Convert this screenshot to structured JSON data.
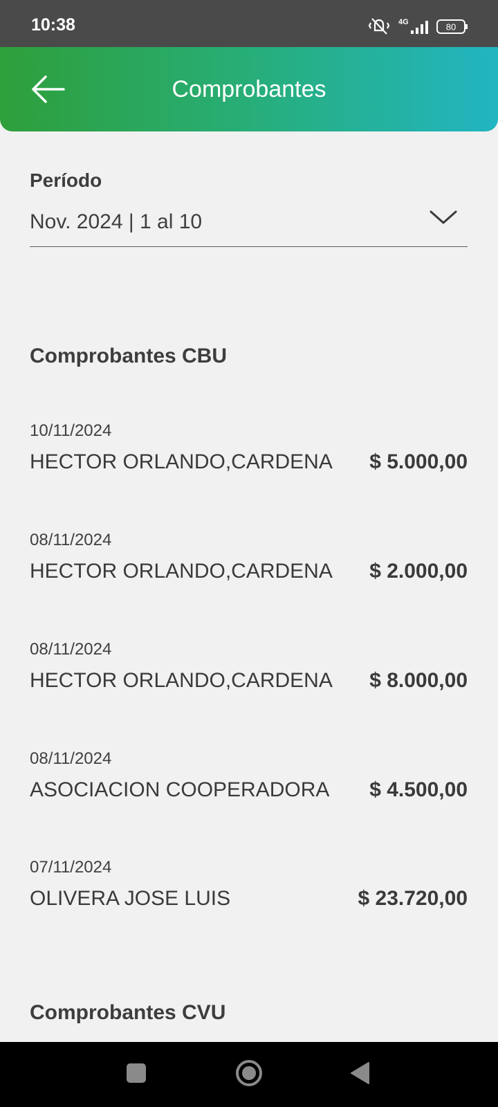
{
  "status": {
    "time": "10:38",
    "network": "4G",
    "battery": "80",
    "icons": [
      "mute-vibrate-icon",
      "signal-icon",
      "battery-icon"
    ]
  },
  "header": {
    "title": "Comprobantes",
    "back_icon": "arrow-left-icon"
  },
  "period": {
    "label": "Período",
    "value": "Nov. 2024 | 1 al 10",
    "icon": "chevron-down-icon"
  },
  "sections": {
    "cbu_title": "Comprobantes CBU",
    "cvu_title": "Comprobantes CVU"
  },
  "items": [
    {
      "date": "10/11/2024",
      "name": "HECTOR ORLANDO,CARDENA",
      "amount": "$ 5.000,00"
    },
    {
      "date": "08/11/2024",
      "name": "HECTOR ORLANDO,CARDENA",
      "amount": "$ 2.000,00"
    },
    {
      "date": "08/11/2024",
      "name": "HECTOR ORLANDO,CARDENA",
      "amount": "$ 8.000,00"
    },
    {
      "date": "08/11/2024",
      "name": "ASOCIACION COOPERADORA",
      "amount": "$ 4.500,00"
    },
    {
      "date": "07/11/2024",
      "name": "OLIVERA JOSE LUIS",
      "amount": "$ 23.720,00"
    }
  ],
  "colors": {
    "header_gradient_start": "#2e9f3a",
    "header_gradient_end": "#22b5c2",
    "background": "#f1f1f1",
    "status_bar": "#4a4a4a"
  },
  "nav": {
    "icons": [
      "recents-square-icon",
      "home-circle-icon",
      "back-triangle-icon"
    ]
  }
}
